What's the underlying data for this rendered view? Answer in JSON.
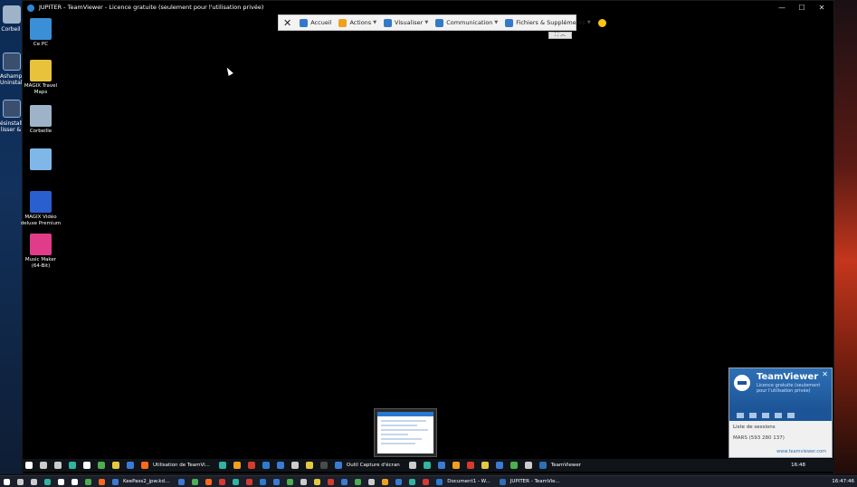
{
  "window": {
    "title": "JUPITER - TeamViewer - Licence gratuite (seulement pour l'utilisation privée)",
    "minimize": "—",
    "maximize": "☐",
    "close": "✕"
  },
  "outer_desktop": {
    "labels": [
      "Corbeil",
      "Ashamp Uninstalle",
      "ésinstall lisser & "
    ]
  },
  "remote_desktop_icons": [
    {
      "label": "Ce PC",
      "icon": "computer-icon",
      "color": "#3b8fd6"
    },
    {
      "label": "MAGIX Travel Maps",
      "icon": "map-pin-icon",
      "color": "#e8c23a"
    },
    {
      "label": "Corbeille",
      "icon": "recycle-bin-icon",
      "color": "#9fb3c8"
    },
    {
      "label": "",
      "icon": "app-icon",
      "color": "#7fb8e8"
    },
    {
      "label": "MAGIX Vidéo deluxe Premium",
      "icon": "magix-video-icon",
      "color": "#2a5fd0"
    },
    {
      "label": "Music Maker (64-Bit)",
      "icon": "music-maker-icon",
      "color": "#e03c8a"
    }
  ],
  "toolbar": {
    "close_icon": "close-icon",
    "items": [
      {
        "label": "Accueil",
        "icon": "home-icon",
        "has_caret": false,
        "color": "#3479c9"
      },
      {
        "label": "Actions",
        "icon": "lightning-icon",
        "has_caret": true,
        "color": "#f0a020"
      },
      {
        "label": "Visualiser",
        "icon": "monitor-icon",
        "has_caret": true,
        "color": "#3479c9"
      },
      {
        "label": "Communication",
        "icon": "chat-icon",
        "has_caret": true,
        "color": "#3479c9"
      },
      {
        "label": "Fichiers & Suppléments",
        "icon": "files-icon",
        "has_caret": true,
        "color": "#3479c9"
      }
    ],
    "smiley_icon": "smiley-icon",
    "sub_controls": "⛶ ︿"
  },
  "tv_panel": {
    "name": "TeamViewer",
    "subtitle": "Licence gratuite (seulement pour l'utilisation privée)",
    "close": "✕",
    "sessions_header": "Liste de sessions",
    "session_row": "MARS (593 280 137)",
    "link": "www.teamviewer.com"
  },
  "remote_taskbar": {
    "items": [
      {
        "label": "",
        "color": "#ffffff",
        "icon": "windows-start-icon"
      },
      {
        "label": "",
        "color": "#cccccc",
        "icon": "search-icon"
      },
      {
        "label": "",
        "color": "#cccccc",
        "icon": "task-view-icon"
      },
      {
        "label": "",
        "color": "#2fb5a0",
        "icon": "edge-icon"
      },
      {
        "label": "",
        "color": "#ffffff",
        "icon": "app-icon"
      },
      {
        "label": "",
        "color": "#4caf50",
        "icon": "app-icon"
      },
      {
        "label": "",
        "color": "#e6c840",
        "icon": "app-icon"
      },
      {
        "label": "",
        "color": "#3a7bd5",
        "icon": "app-icon"
      },
      {
        "label": "Utilisation de TeamVi...",
        "color": "#ff6a1a",
        "icon": "firefox-icon"
      },
      {
        "label": "",
        "color": "#2fb5a0",
        "icon": "edge-icon"
      },
      {
        "label": "",
        "color": "#f0a020",
        "icon": "app-icon"
      },
      {
        "label": "",
        "color": "#d83b2e",
        "icon": "pdf-icon"
      },
      {
        "label": "",
        "color": "#2b7cd3",
        "icon": "word-icon"
      },
      {
        "label": "",
        "color": "#3a7bd5",
        "icon": "app-icon"
      },
      {
        "label": "",
        "color": "#cccccc",
        "icon": "app-icon"
      },
      {
        "label": "",
        "color": "#e6c840",
        "icon": "app-icon"
      },
      {
        "label": "",
        "color": "#4a4a4a",
        "icon": "app-icon"
      },
      {
        "label": "Outil Capture d'écran",
        "color": "#3a7bd5",
        "icon": "snipping-tool-icon"
      },
      {
        "label": "",
        "color": "#cccccc",
        "icon": "app-icon"
      },
      {
        "label": "",
        "color": "#2fb5a0",
        "icon": "app-icon"
      },
      {
        "label": "",
        "color": "#3a7bd5",
        "icon": "app-icon"
      },
      {
        "label": "",
        "color": "#f0a020",
        "icon": "app-icon"
      },
      {
        "label": "",
        "color": "#d83b2e",
        "icon": "app-icon"
      },
      {
        "label": "",
        "color": "#e6c840",
        "icon": "app-icon"
      },
      {
        "label": "",
        "color": "#3a7bd5",
        "icon": "app-icon"
      },
      {
        "label": "",
        "color": "#4caf50",
        "icon": "app-icon"
      },
      {
        "label": "",
        "color": "#cccccc",
        "icon": "app-icon"
      },
      {
        "label": "TeamViewer",
        "color": "#2e6fb5",
        "icon": "teamviewer-icon"
      }
    ],
    "clock": "16:48"
  },
  "local_taskbar": {
    "items": [
      {
        "label": "",
        "color": "#ffffff",
        "icon": "windows-start-icon"
      },
      {
        "label": "",
        "color": "#cccccc",
        "icon": "search-icon"
      },
      {
        "label": "",
        "color": "#cccccc",
        "icon": "task-view-icon"
      },
      {
        "label": "",
        "color": "#2fb5a0",
        "icon": "edge-icon"
      },
      {
        "label": "",
        "color": "#ffffff",
        "icon": "app-icon"
      },
      {
        "label": "",
        "color": "#ffffff",
        "icon": "settings-icon"
      },
      {
        "label": "",
        "color": "#4caf50",
        "icon": "app-icon"
      },
      {
        "label": "",
        "color": "#ff6a1a",
        "icon": "app-icon"
      },
      {
        "label": "KeePass2_jpw.kd...",
        "color": "#3a7bd5",
        "icon": "keepass-icon"
      },
      {
        "label": "",
        "color": "#3a7bd5",
        "icon": "app-icon"
      },
      {
        "label": "",
        "color": "#4caf50",
        "icon": "app-icon"
      },
      {
        "label": "",
        "color": "#ff6a1a",
        "icon": "app-icon"
      },
      {
        "label": "",
        "color": "#d83b2e",
        "icon": "app-icon"
      },
      {
        "label": "",
        "color": "#2fb5a0",
        "icon": "edge-icon"
      },
      {
        "label": "",
        "color": "#d83b2e",
        "icon": "pdf-icon"
      },
      {
        "label": "",
        "color": "#2b7cd3",
        "icon": "word-icon"
      },
      {
        "label": "",
        "color": "#3a7bd5",
        "icon": "app-icon"
      },
      {
        "label": "",
        "color": "#4caf50",
        "icon": "app-icon"
      },
      {
        "label": "",
        "color": "#cccccc",
        "icon": "app-icon"
      },
      {
        "label": "",
        "color": "#e6c840",
        "icon": "app-icon"
      },
      {
        "label": "",
        "color": "#d83b2e",
        "icon": "app-icon"
      },
      {
        "label": "",
        "color": "#3a7bd5",
        "icon": "app-icon"
      },
      {
        "label": "",
        "color": "#4caf50",
        "icon": "app-icon"
      },
      {
        "label": "",
        "color": "#cccccc",
        "icon": "app-icon"
      },
      {
        "label": "",
        "color": "#f0a020",
        "icon": "app-icon"
      },
      {
        "label": "",
        "color": "#3a7bd5",
        "icon": "app-icon"
      },
      {
        "label": "",
        "color": "#2fb5a0",
        "icon": "app-icon"
      },
      {
        "label": "",
        "color": "#d83b2e",
        "icon": "app-icon"
      },
      {
        "label": "Document1 - W...",
        "color": "#2b7cd3",
        "icon": "word-icon"
      },
      {
        "label": "JUPITER - TeamVie...",
        "color": "#2e6fb5",
        "icon": "teamviewer-icon"
      }
    ],
    "clock": "16:47:46"
  }
}
